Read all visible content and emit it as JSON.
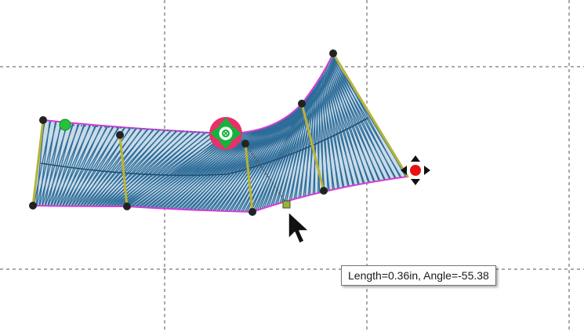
{
  "app": {
    "canvas_label": "",
    "colors": {
      "background": "#ffffff",
      "grid": "#555555",
      "stitch_fill": "#2d6c98",
      "outline": "#d63bd6",
      "rung": "#b9b335",
      "node": "#222222",
      "start_point": "#22c43a",
      "end_point": "#e81010",
      "rotate_handle": "#e8306a",
      "center_ring": "#12b43a"
    },
    "icons": {
      "cursor": "arrow-cursor-icon",
      "move_handle": "four-arrow-move-icon",
      "rotate_handle": "rotate-center-icon"
    }
  },
  "tooltip": {
    "text": "Length=0.36in, Angle=-55.38"
  }
}
